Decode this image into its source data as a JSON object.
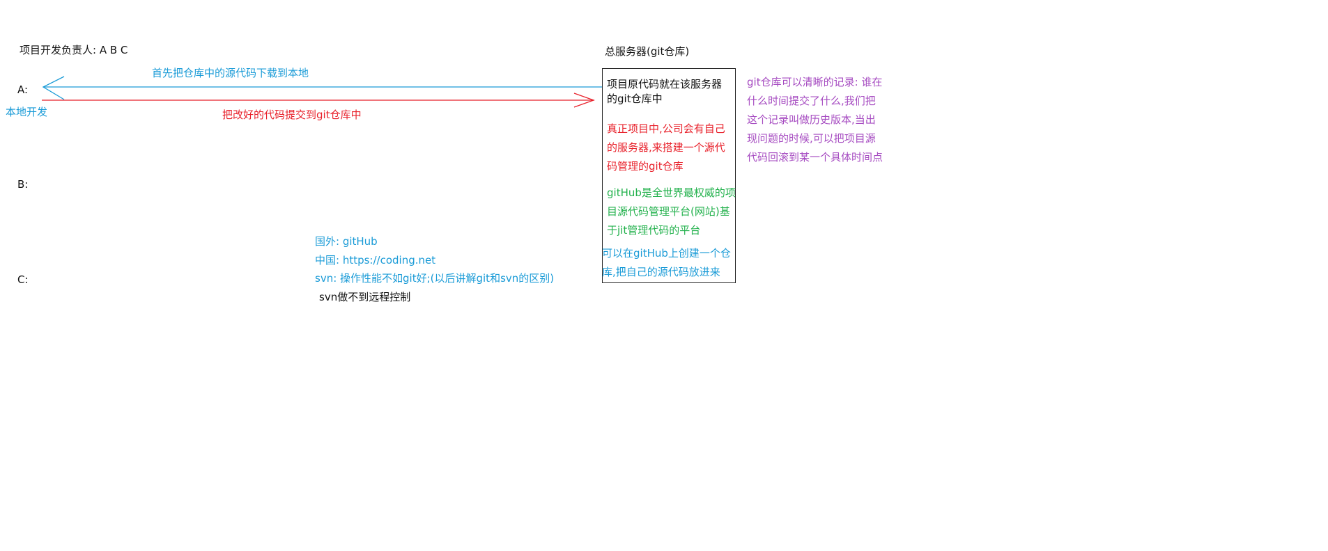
{
  "team_label": "项目开发负责人: A  B  C",
  "server_title": "总服务器(git仓库)",
  "devs": [
    "A:",
    "B:",
    "C:"
  ],
  "local_dev_label": "本地开发",
  "arrow_download_label": "首先把仓库中的源代码下载到本地",
  "arrow_upload_label": "把改好的代码提交到git仓库中",
  "server_box": {
    "intro": "项目原代码就在该服务器的git仓库中",
    "company_note": "真正项目中,公司会有自己的服务器,来搭建一个源代码管理的git仓库",
    "github_note": "gitHub是全世界最权威的项目源代码管理平台(网站)基于jit管理代码的平台",
    "create_note": "可以在gitHub上创建一个仓库,把自己的源代码放进来"
  },
  "history_note": "git仓库可以清晰的记录: 谁在什么时间提交了什么,我们把这个记录叫做历史版本,当出现问题的时候,可以把项目源代码回滚到某一个具体时间点",
  "platforms": {
    "foreign": "国外: gitHub",
    "china": "中国: https://coding.net",
    "svn": "svn: 操作性能不如git好;(以后讲解git和svn的区别)",
    "svn_remote": "svn做不到远程控制"
  },
  "colors": {
    "download_arrow": "#1a9bd7",
    "upload_arrow": "#e8202a",
    "company_note": "#e8202a",
    "github_note": "#22b14c",
    "history_note": "#a64bc1"
  }
}
